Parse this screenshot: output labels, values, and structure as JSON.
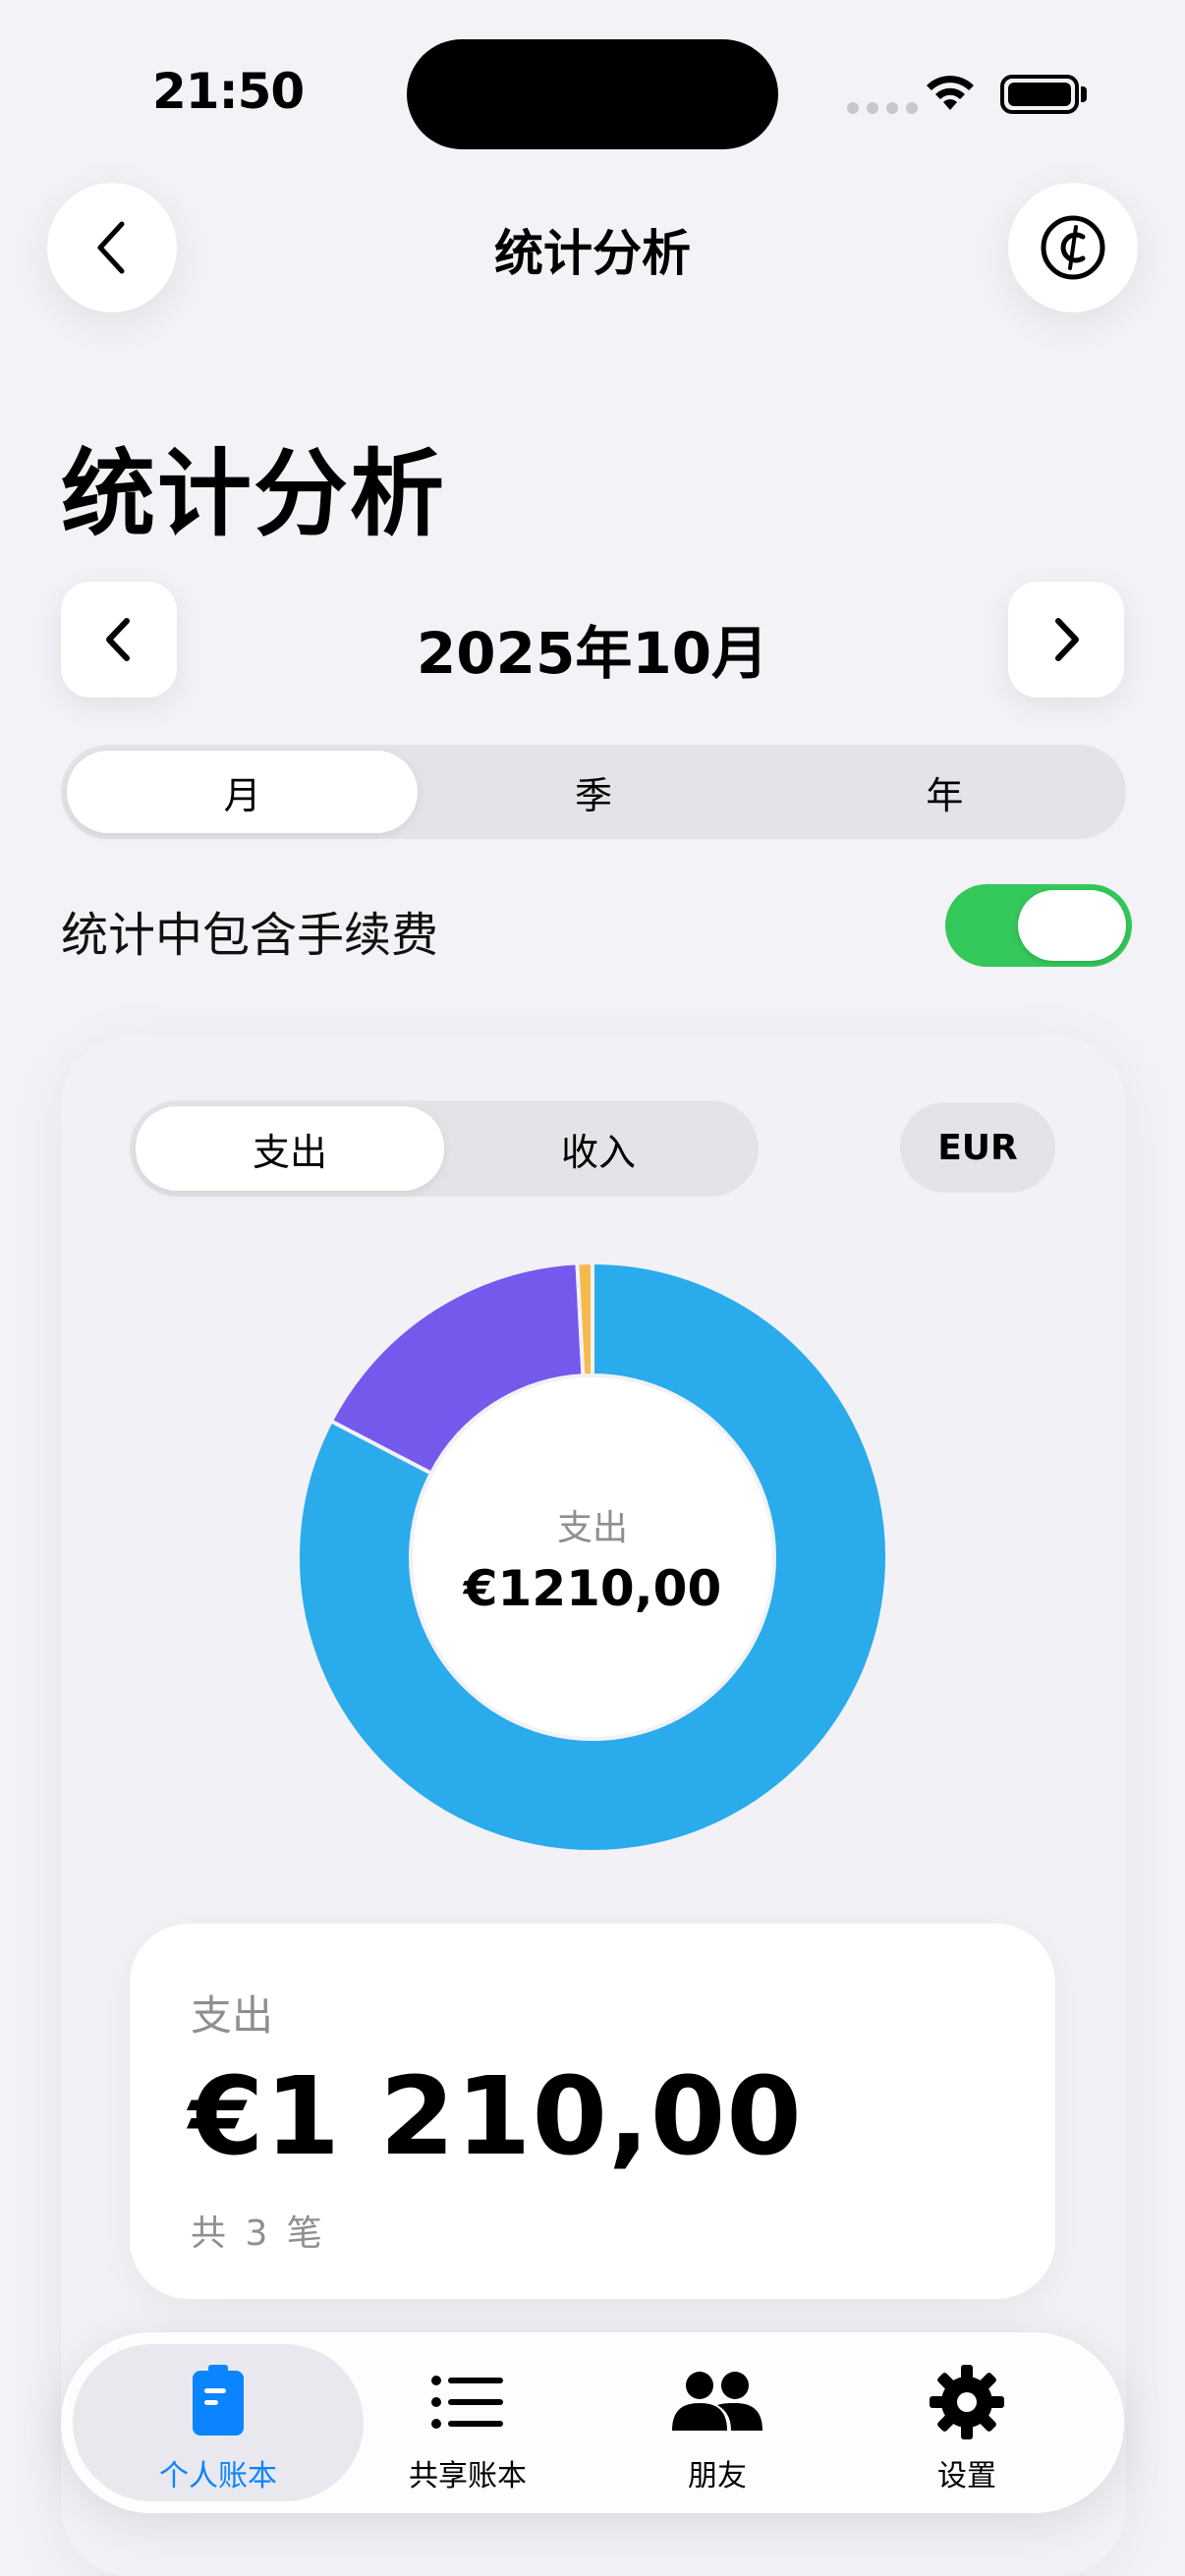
{
  "status_bar": {
    "time": "21:50"
  },
  "header": {
    "title": "统计分析",
    "back_icon": "chevron-left-icon",
    "currency_icon": "cedi-sign-icon"
  },
  "page_title": "统计分析",
  "period": {
    "label": "2025年10月"
  },
  "period_tabs": [
    "月",
    "季",
    "年"
  ],
  "period_tab_selected": "月",
  "fee_toggle": {
    "label": "统计中包含手续费",
    "on": true
  },
  "type_tabs": [
    "支出",
    "收入"
  ],
  "type_tab_selected": "支出",
  "currency": "EUR",
  "donut": {
    "center_label": "支出",
    "center_value": "€1210,00"
  },
  "summary": {
    "label": "支出",
    "value": "€1 210,00",
    "count": "共 3 笔"
  },
  "chart_data": {
    "type": "pie",
    "variant": "donut",
    "values": [
      1000,
      200,
      10
    ],
    "colors": [
      "#2aabeb",
      "#7558ec",
      "#f6b94c"
    ]
  },
  "tabbar": {
    "items": [
      {
        "label": "个人账本",
        "icon": "ledger-icon",
        "active": true
      },
      {
        "label": "共享账本",
        "icon": "list-icon",
        "active": false
      },
      {
        "label": "朋友",
        "icon": "friends-icon",
        "active": false
      },
      {
        "label": "设置",
        "icon": "gear-icon",
        "active": false
      }
    ]
  },
  "colors": {
    "accent": "#0a84ff",
    "toggle_on": "#34c759",
    "background": "#f2f2f7"
  }
}
